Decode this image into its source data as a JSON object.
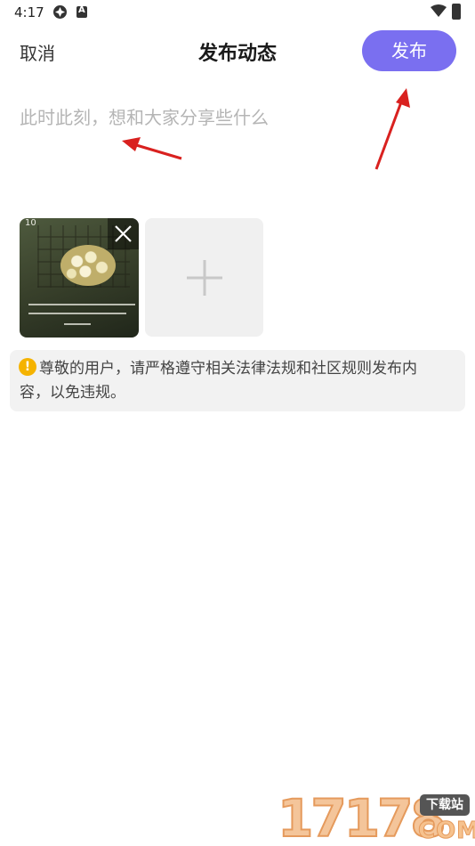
{
  "status_bar": {
    "time": "4:17",
    "icons": [
      "sync-icon",
      "a-badge-icon",
      "wifi-icon",
      "battery-icon"
    ]
  },
  "header": {
    "cancel_label": "取消",
    "title": "发布动态",
    "publish_label": "发布"
  },
  "composer": {
    "placeholder": "此时此刻，想和大家分享些什么",
    "value": ""
  },
  "images": {
    "thumbnail_date": "10",
    "add_icon": "plus-icon",
    "remove_icon": "close-icon"
  },
  "notice": {
    "icon": "!",
    "line1": "尊敬的用户，请严格遵守相关法律法规和社区规则发布内",
    "line2": "容，以免违规。"
  },
  "watermark": {
    "digits": "17178",
    "tag": "下载站",
    "suffix": "COM"
  },
  "colors": {
    "accent": "#7a6ff0",
    "warning": "#f5b300",
    "annotation_arrow": "#d9211f"
  }
}
